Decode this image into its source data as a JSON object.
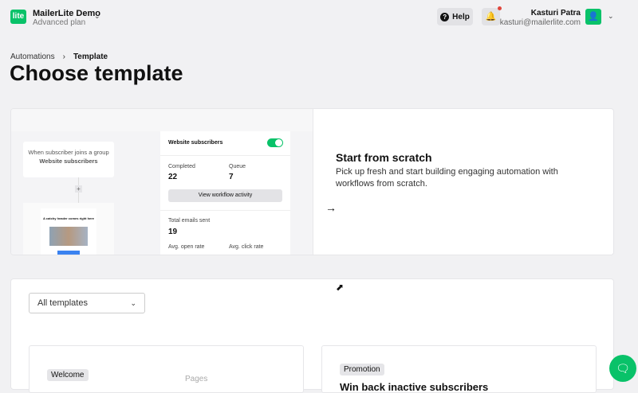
{
  "header": {
    "logo_text": "lite",
    "account_name": "MailerLite Demo",
    "plan": "Advanced plan",
    "help_label": "Help",
    "user_name": "Kasturi Patra",
    "user_email": "kasturi@mailerlite.com"
  },
  "breadcrumb": {
    "parent": "Automations",
    "current": "Template"
  },
  "page_title": "Choose template",
  "scratch_card": {
    "preview": {
      "trigger_text": "When subscriber joins a group",
      "trigger_group": "Website subscribers",
      "email_headline": "A catchy header comes right here",
      "group_name": "Website subscribers",
      "completed_label": "Completed",
      "completed_value": "22",
      "queue_label": "Queue",
      "queue_value": "7",
      "view_activity_label": "View workflow activity",
      "total_sent_label": "Total emails sent",
      "total_sent_value": "19",
      "open_rate_label": "Avg. open rate",
      "click_rate_label": "Avg. click rate"
    },
    "title": "Start from scratch",
    "description": "Pick up fresh and start building engaging automation with workflows from scratch."
  },
  "filter": {
    "selected": "All templates"
  },
  "templates": [
    {
      "badge": "Welcome",
      "title": ""
    },
    {
      "badge": "Promotion",
      "title": "Win back inactive subscribers"
    }
  ],
  "pages_label": "Pages",
  "colors": {
    "brand": "#09c269",
    "notification": "#e0463c"
  }
}
